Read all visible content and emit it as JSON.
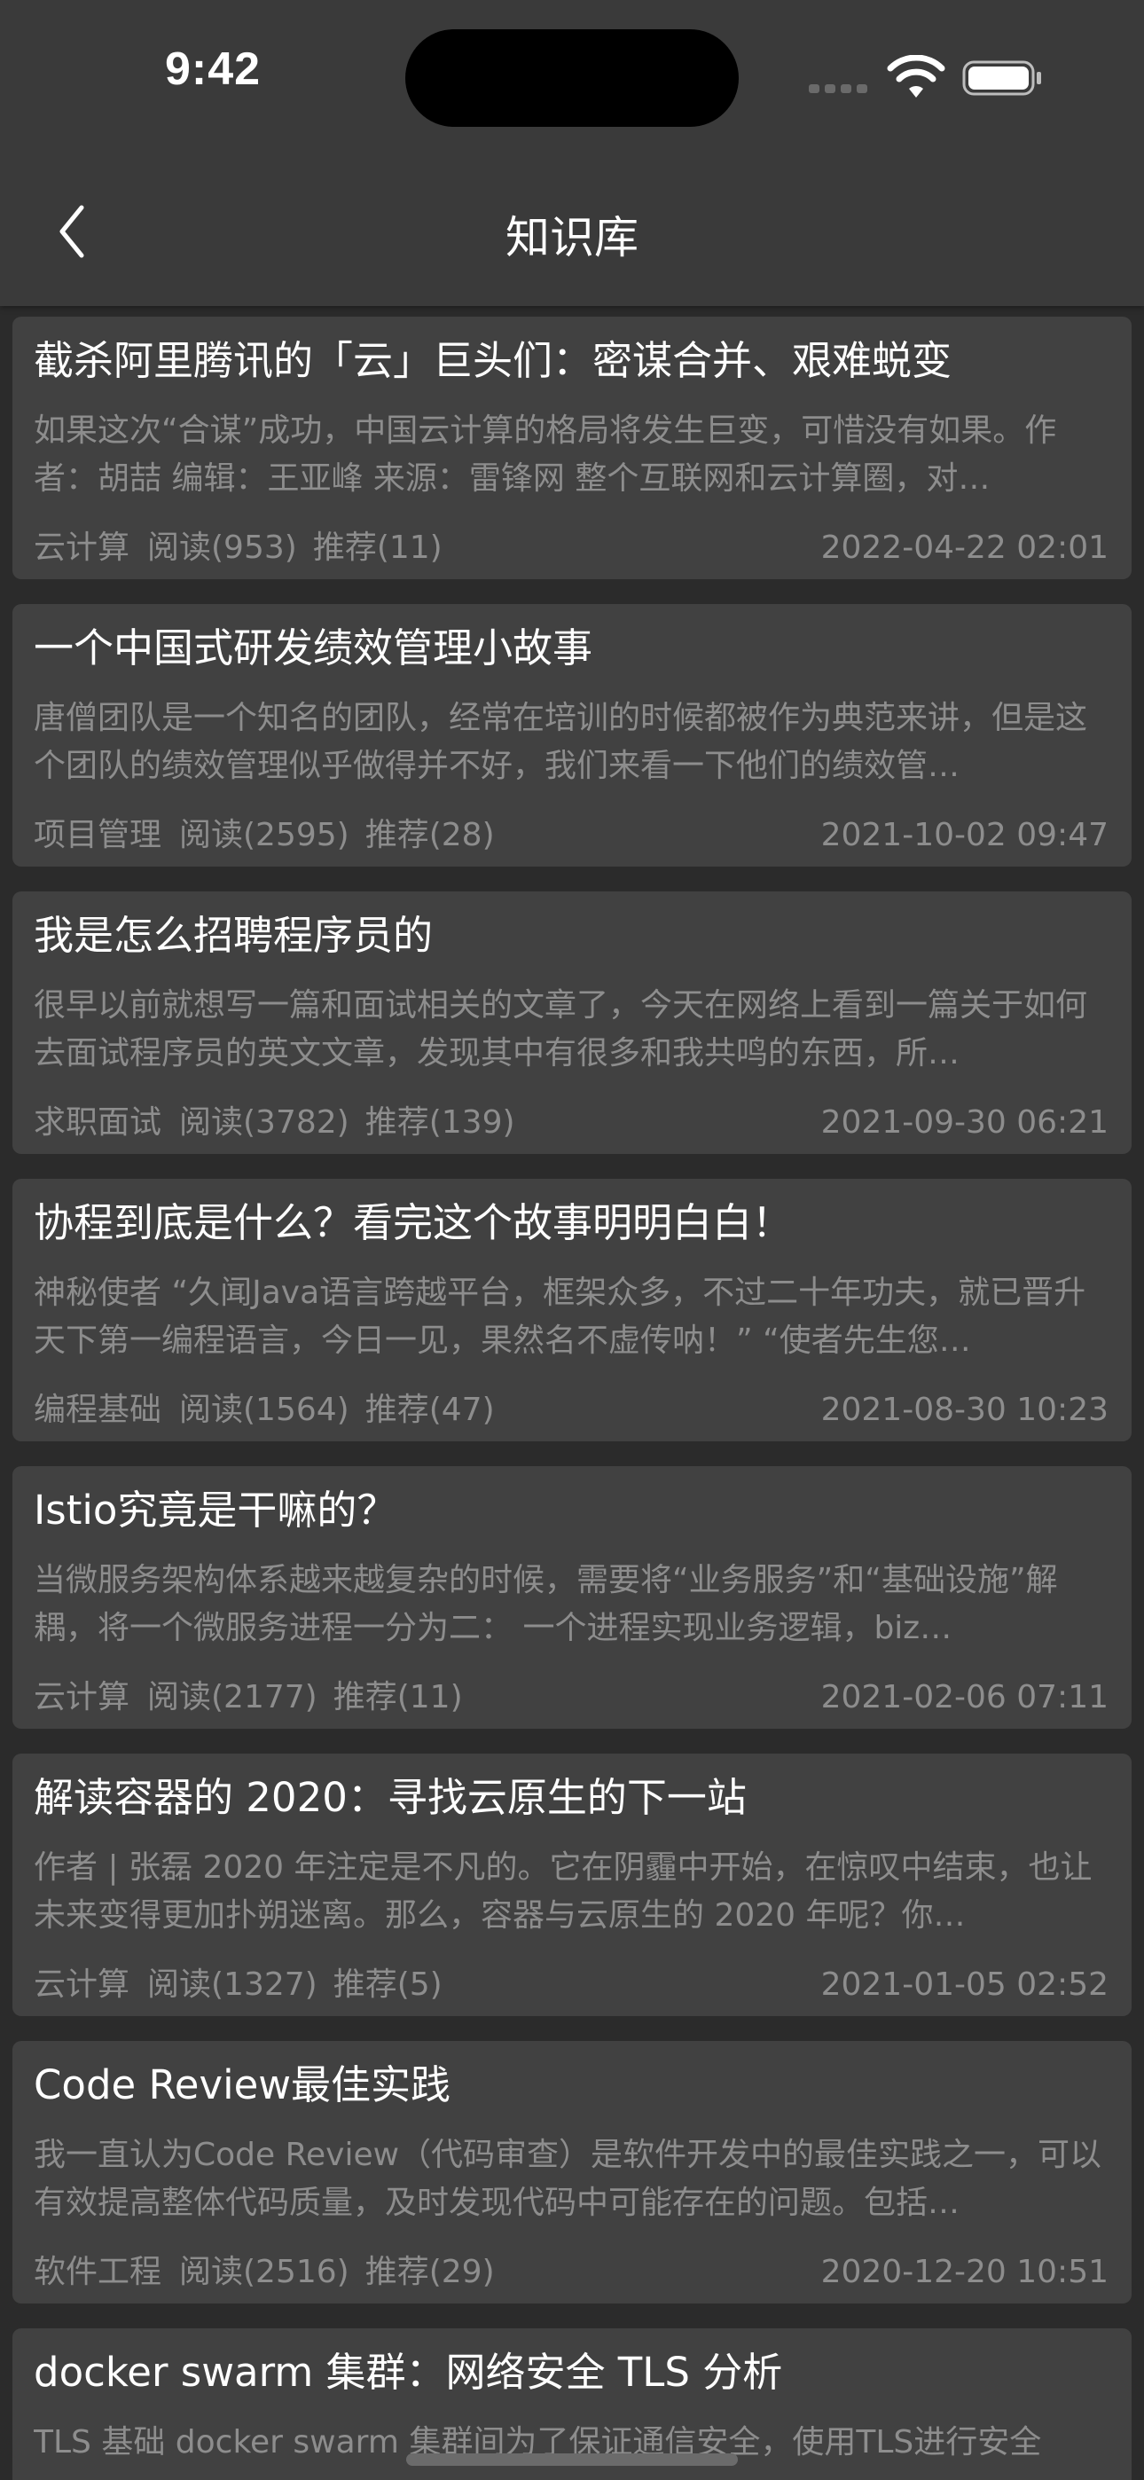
{
  "status_bar": {
    "time": "9:42"
  },
  "nav": {
    "title": "知识库",
    "back_icon": "chevron-left-icon"
  },
  "colors": {
    "background": "#2b2b2b",
    "header": "#3a3a3a",
    "card": "#414141",
    "title_text": "#ffffff",
    "secondary_text": "#8d8d8d"
  },
  "articles": [
    {
      "title": "截杀阿里腾讯的「云」巨头们：密谋合并、艰难蜕变",
      "summary": "如果这次“合谋”成功，中国云计算的格局将发生巨变，可惜没有如果。作者：胡喆 编辑：王亚峰 来源：雷锋网 整个互联网和云计算圈，对…",
      "tag": "云计算",
      "reads": "阅读(953)",
      "likes": "推荐(11)",
      "date": "2022-04-22 02:01"
    },
    {
      "title": "一个中国式研发绩效管理小故事",
      "summary": "唐僧团队是一个知名的团队，经常在培训的时候都被作为典范来讲，但是这个团队的绩效管理似乎做得并不好，我们来看一下他们的绩效管…",
      "tag": "项目管理",
      "reads": "阅读(2595)",
      "likes": "推荐(28)",
      "date": "2021-10-02 09:47"
    },
    {
      "title": "我是怎么招聘程序员的",
      "summary": "很早以前就想写一篇和面试相关的文章了，今天在网络上看到一篇关于如何去面试程序员的英文文章，发现其中有很多和我共鸣的东西，所…",
      "tag": "求职面试",
      "reads": "阅读(3782)",
      "likes": "推荐(139)",
      "date": "2021-09-30 06:21"
    },
    {
      "title": "协程到底是什么？看完这个故事明明白白！",
      "summary": "神秘使者 “久闻Java语言跨越平台，框架众多，不过二十年功夫，就已晋升天下第一编程语言，今日一见，果然名不虚传呐！” “使者先生您…",
      "tag": "编程基础",
      "reads": "阅读(1564)",
      "likes": "推荐(47)",
      "date": "2021-08-30 10:23"
    },
    {
      "title": "Istio究竟是干嘛的？",
      "summary": "当微服务架构体系越来越复杂的时候，需要将“业务服务”和“基础设施”解耦，将一个微服务进程一分为二： 一个进程实现业务逻辑，biz…",
      "tag": "云计算",
      "reads": "阅读(2177)",
      "likes": "推荐(11)",
      "date": "2021-02-06 07:11"
    },
    {
      "title": "解读容器的 2020：寻找云原生的下一站",
      "summary": "作者 | 张磊 2020 年注定是不凡的。它在阴霾中开始，在惊叹中结束，也让未来变得更加扑朔迷离。那么，容器与云原生的 2020 年呢？你…",
      "tag": "云计算",
      "reads": "阅读(1327)",
      "likes": "推荐(5)",
      "date": "2021-01-05 02:52"
    },
    {
      "title": "Code Review最佳实践",
      "summary": "我一直认为Code Review（代码审查）是软件开发中的最佳实践之一，可以有效提高整体代码质量，及时发现代码中可能存在的问题。包括…",
      "tag": "软件工程",
      "reads": "阅读(2516)",
      "likes": "推荐(29)",
      "date": "2020-12-20 10:51"
    },
    {
      "title": "docker swarm 集群：网络安全 TLS 分析",
      "summary": "TLS 基础 docker swarm 集群间为了保证通信安全，使用TLS进行安全",
      "tag": "",
      "reads": "",
      "likes": "",
      "date": ""
    }
  ]
}
